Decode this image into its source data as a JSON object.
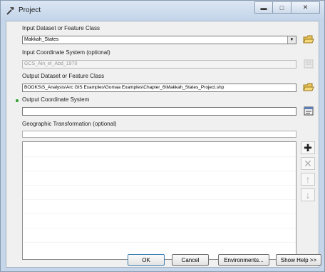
{
  "window": {
    "title": "Project"
  },
  "labels": {
    "input_dataset": "Input Dataset or Feature Class",
    "input_coord": "Input Coordinate System (optional)",
    "output_dataset": "Output Dataset or Feature Class",
    "output_coord": "Output Coordinate System",
    "geo_transform": "Geographic Transformation (optional)"
  },
  "fields": {
    "input_dataset_value": "Makkah_States",
    "input_coord_value": "GCS_Ain_el_Abd_1970",
    "output_dataset_value": "BOOKS\\S_Analysis\\Arc GIS Examples\\Gomaa Examples\\Chapter_6\\Makkah_States_Project.shp",
    "output_coord_value": "",
    "geo_transform_value": ""
  },
  "buttons": {
    "ok": "OK",
    "cancel": "Cancel",
    "environments": "Environments...",
    "show_help": "Show Help >>"
  },
  "colors": {
    "required_dot": "#2ca02c"
  }
}
